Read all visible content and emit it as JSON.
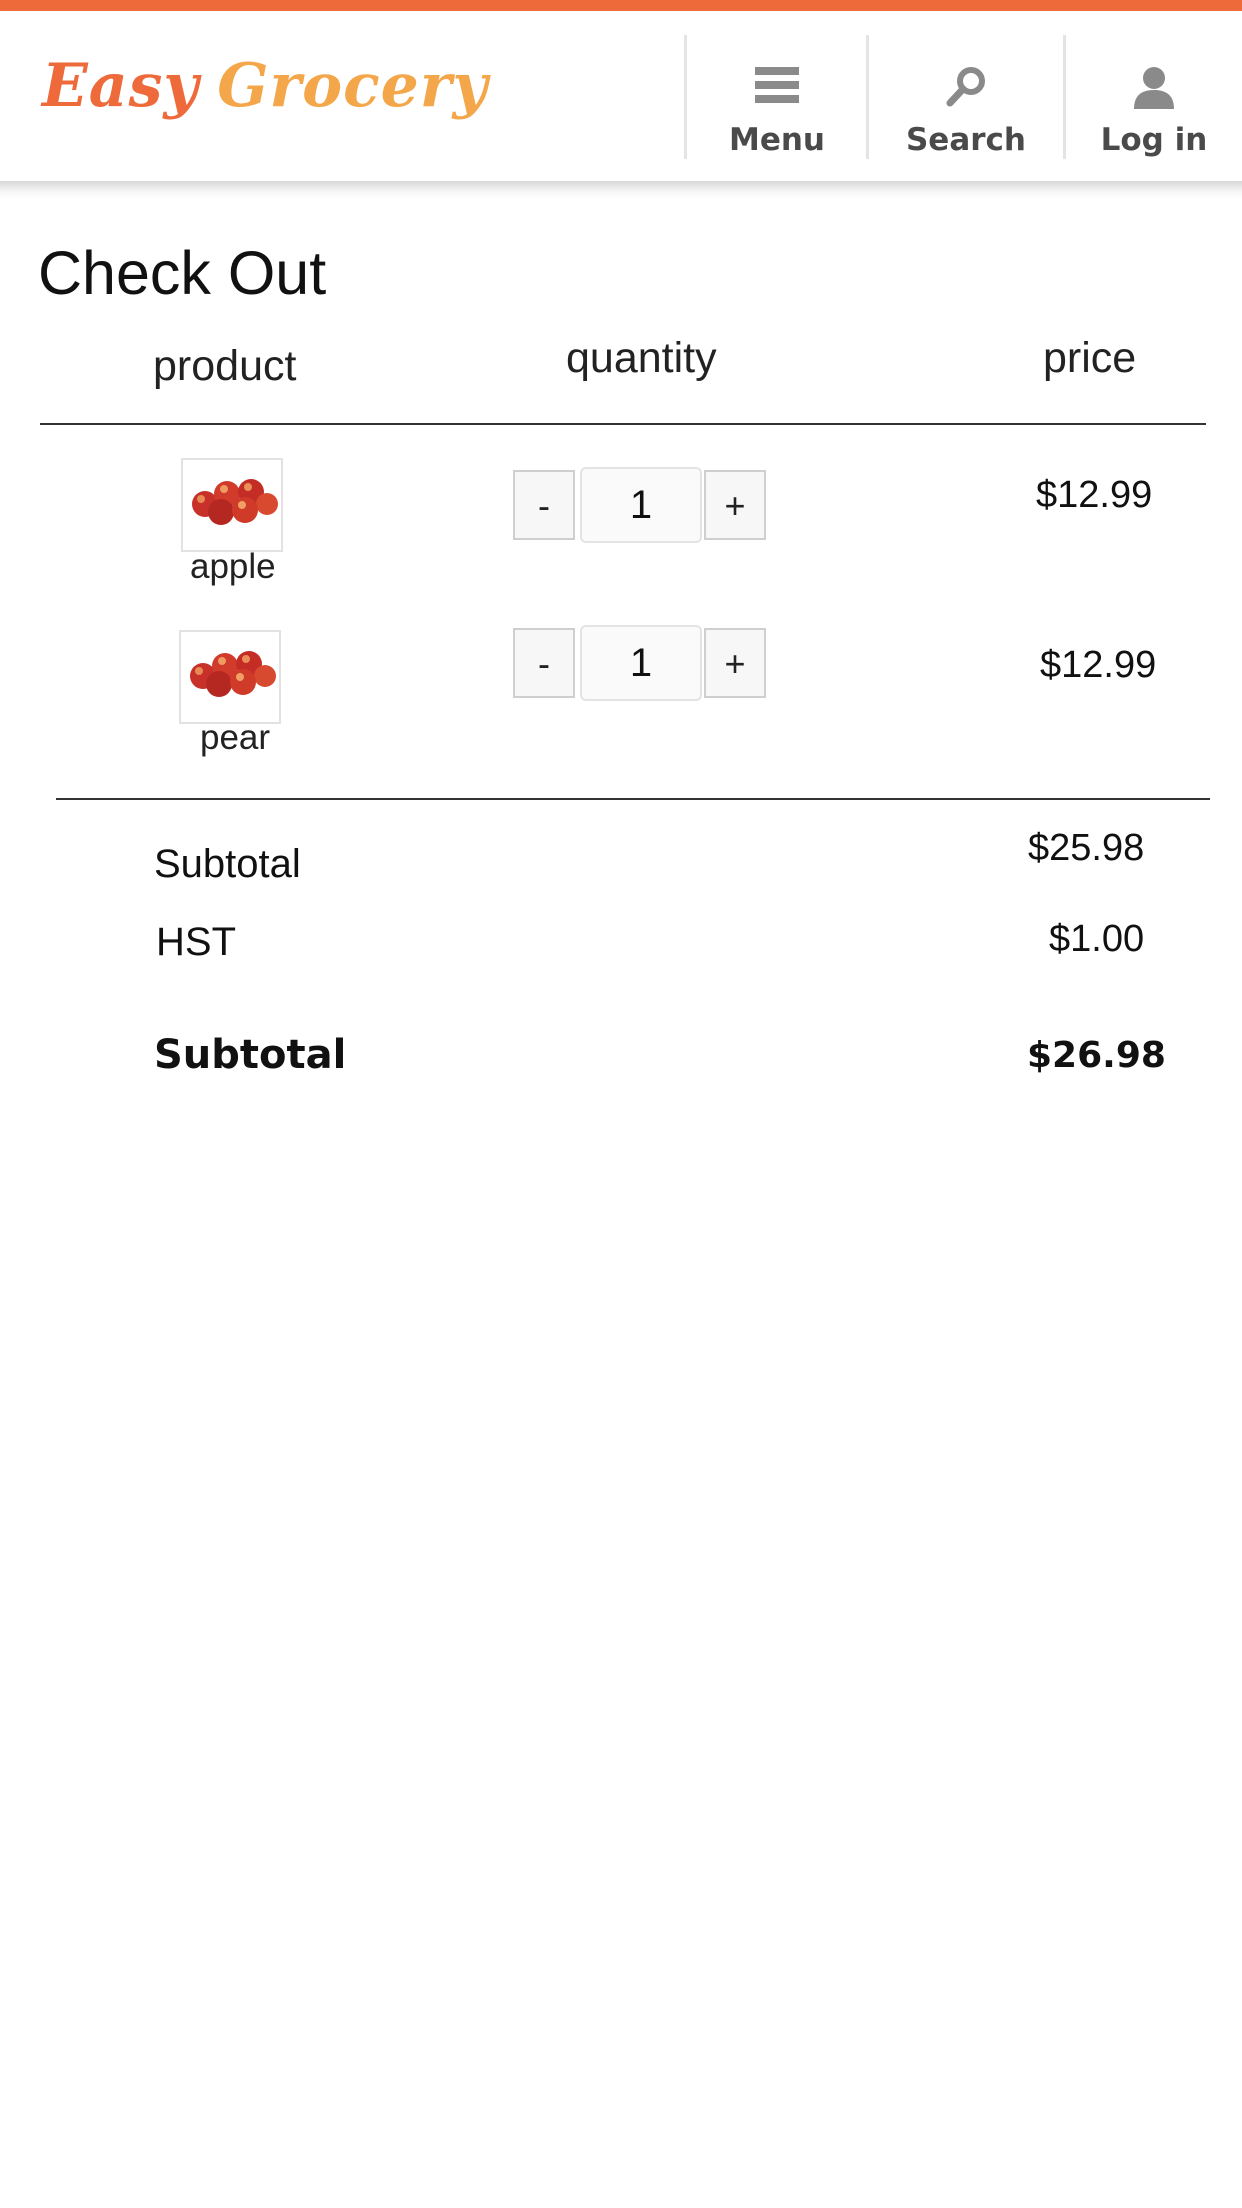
{
  "header": {
    "logo_word1": "Easy",
    "logo_word2": "Grocery",
    "nav": [
      {
        "label": "Menu",
        "icon": "hamburger-icon"
      },
      {
        "label": "Search",
        "icon": "search-icon"
      },
      {
        "label": "Log in",
        "icon": "user-icon"
      }
    ]
  },
  "colors": {
    "accent": "#ee6a3a",
    "accent_light": "#f4a74a",
    "text": "#111111"
  },
  "page_title": "Check Out",
  "table": {
    "columns": [
      "product",
      "quantity",
      "price"
    ],
    "rows": [
      {
        "name": "apple",
        "quantity": "1",
        "price": "$12.99",
        "image": "apples-thumbnail"
      },
      {
        "name": "pear",
        "quantity": "1",
        "price": "$12.99",
        "image": "apples-thumbnail"
      }
    ],
    "decrement_label": "-",
    "increment_label": "+"
  },
  "summary": {
    "subtotal_label": "Subtotal",
    "subtotal_value": "$25.98",
    "tax_label": "HST",
    "tax_value": "$1.00",
    "total_label": "Subtotal",
    "total_value": "$26.98"
  }
}
